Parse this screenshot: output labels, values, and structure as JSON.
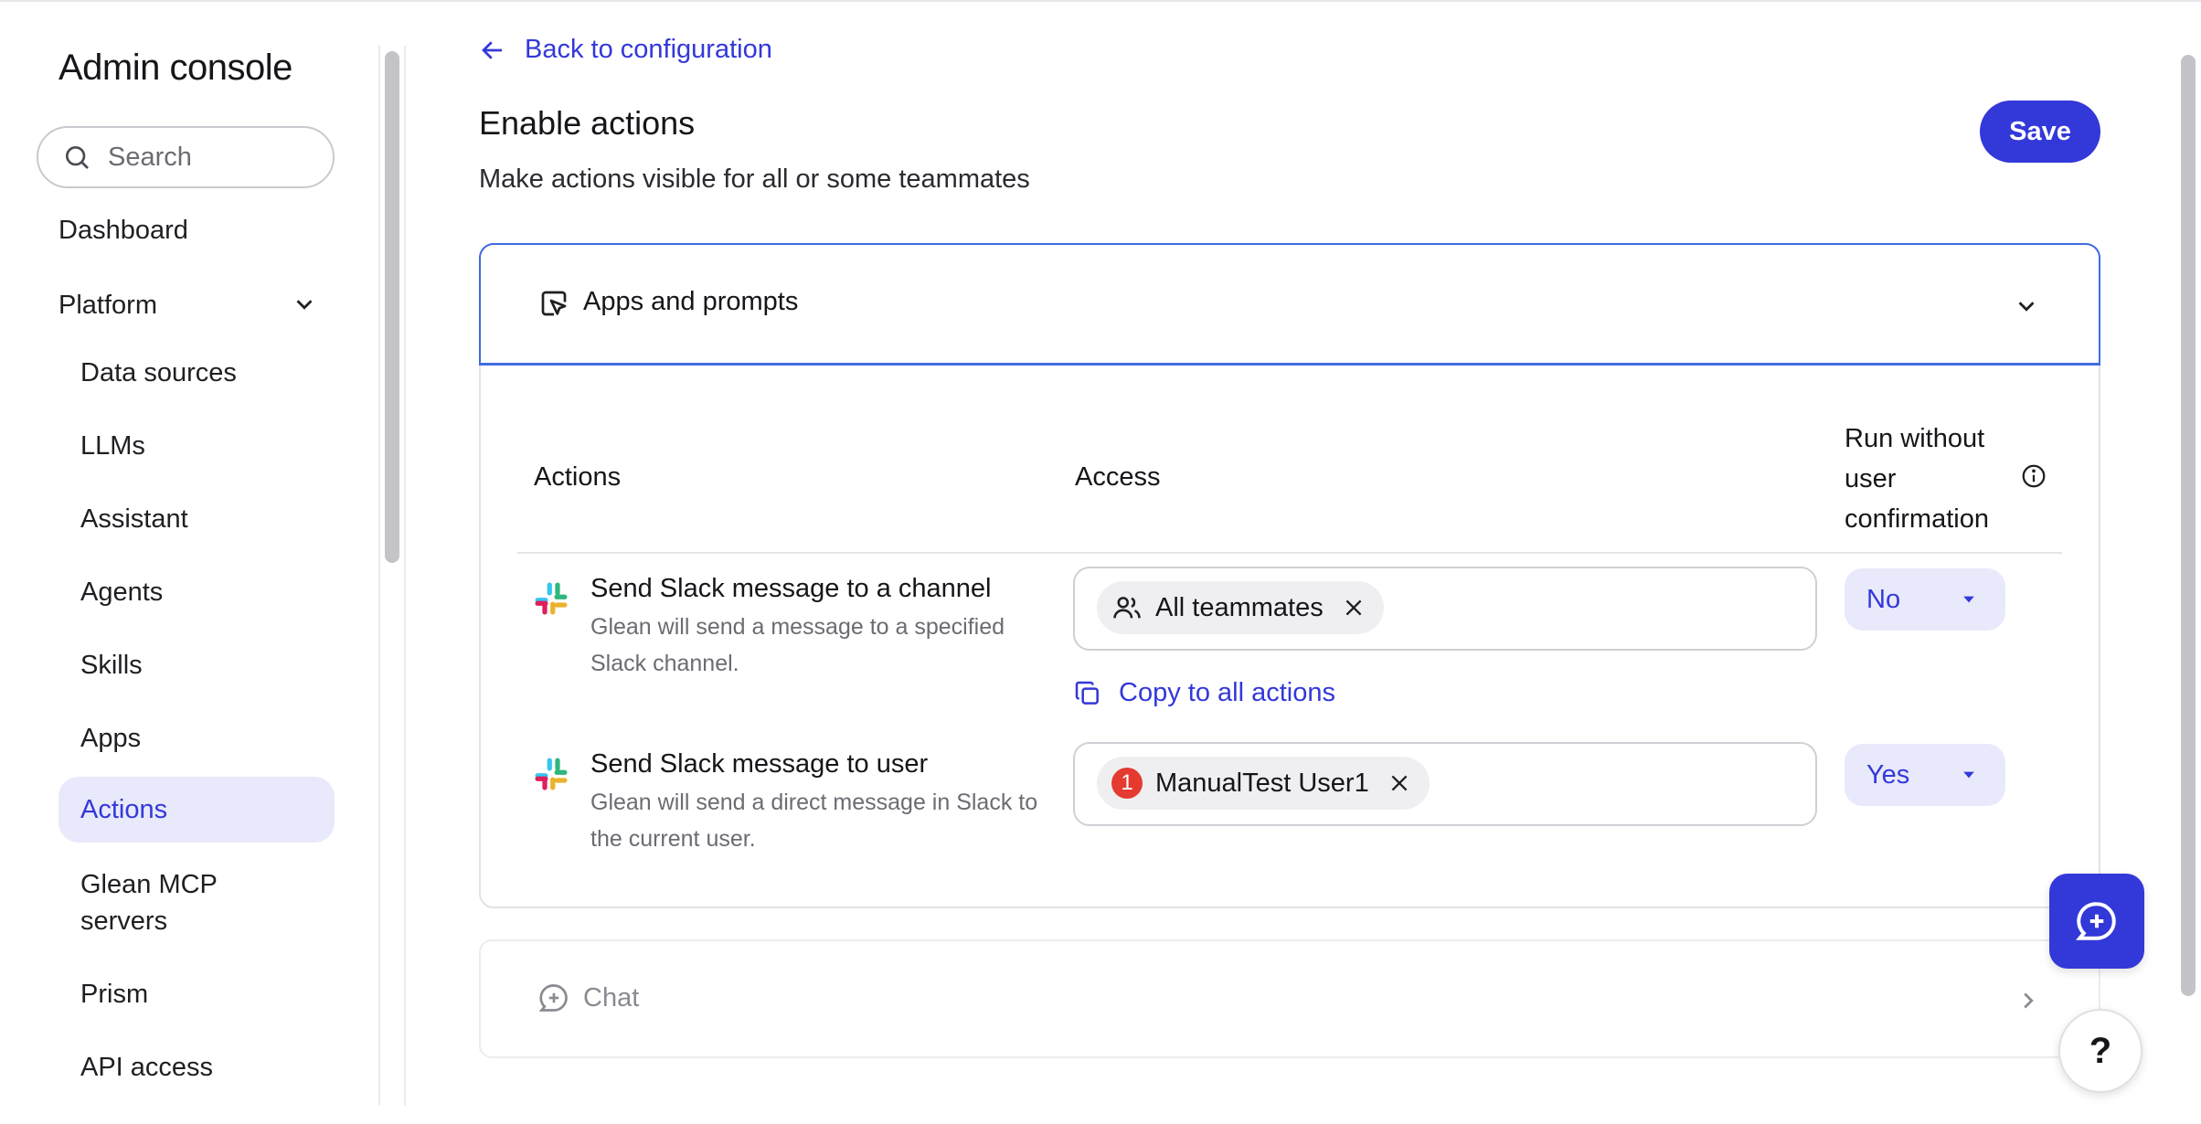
{
  "sidebar": {
    "title": "Admin console",
    "search_placeholder": "Search",
    "dashboard": "Dashboard",
    "platform": "Platform",
    "items": [
      {
        "label": "Data sources"
      },
      {
        "label": "LLMs"
      },
      {
        "label": "Assistant"
      },
      {
        "label": "Agents"
      },
      {
        "label": "Skills"
      },
      {
        "label": "Apps"
      },
      {
        "label": "Actions"
      },
      {
        "label": "Glean MCP"
      },
      {
        "label": "servers"
      },
      {
        "label": "Prism"
      },
      {
        "label": "API access"
      }
    ],
    "active_item": "Actions"
  },
  "main": {
    "back_link": "Back to configuration",
    "title": "Enable actions",
    "subtitle": "Make actions visible for all or some teammates",
    "save_label": "Save",
    "section": {
      "label": "Apps and prompts",
      "columns": {
        "actions": "Actions",
        "access": "Access",
        "run_line1": "Run without",
        "run_line2": "user",
        "run_line3": "confirmation"
      },
      "rows": [
        {
          "title": "Send Slack message to a channel",
          "desc_line1": "Glean will send a message to a specified",
          "desc_line2": "Slack channel.",
          "chip": "All teammates",
          "run": "No"
        },
        {
          "title": "Send Slack message to user",
          "desc_line1": "Glean will send a direct message in Slack to",
          "desc_line2": "the current user.",
          "chip": "ManualTest User1",
          "chip_badge": "1",
          "run": "Yes"
        }
      ],
      "copy_link": "Copy to all actions"
    },
    "chat_section": {
      "label": "Chat"
    }
  },
  "help_label": "?",
  "colors": {
    "accent": "#3338d9",
    "active_bg": "#e8e9fb",
    "section_border": "#3f6ce0",
    "badge": "#e53a2f"
  },
  "icons": [
    "search-icon",
    "chevron-down-icon",
    "arrow-left-icon",
    "cursor-prompt-icon",
    "info-icon",
    "slack-icon",
    "users-icon",
    "close-icon",
    "copy-icon",
    "caret-down-icon",
    "chat-plus-icon",
    "chevron-right-icon"
  ]
}
